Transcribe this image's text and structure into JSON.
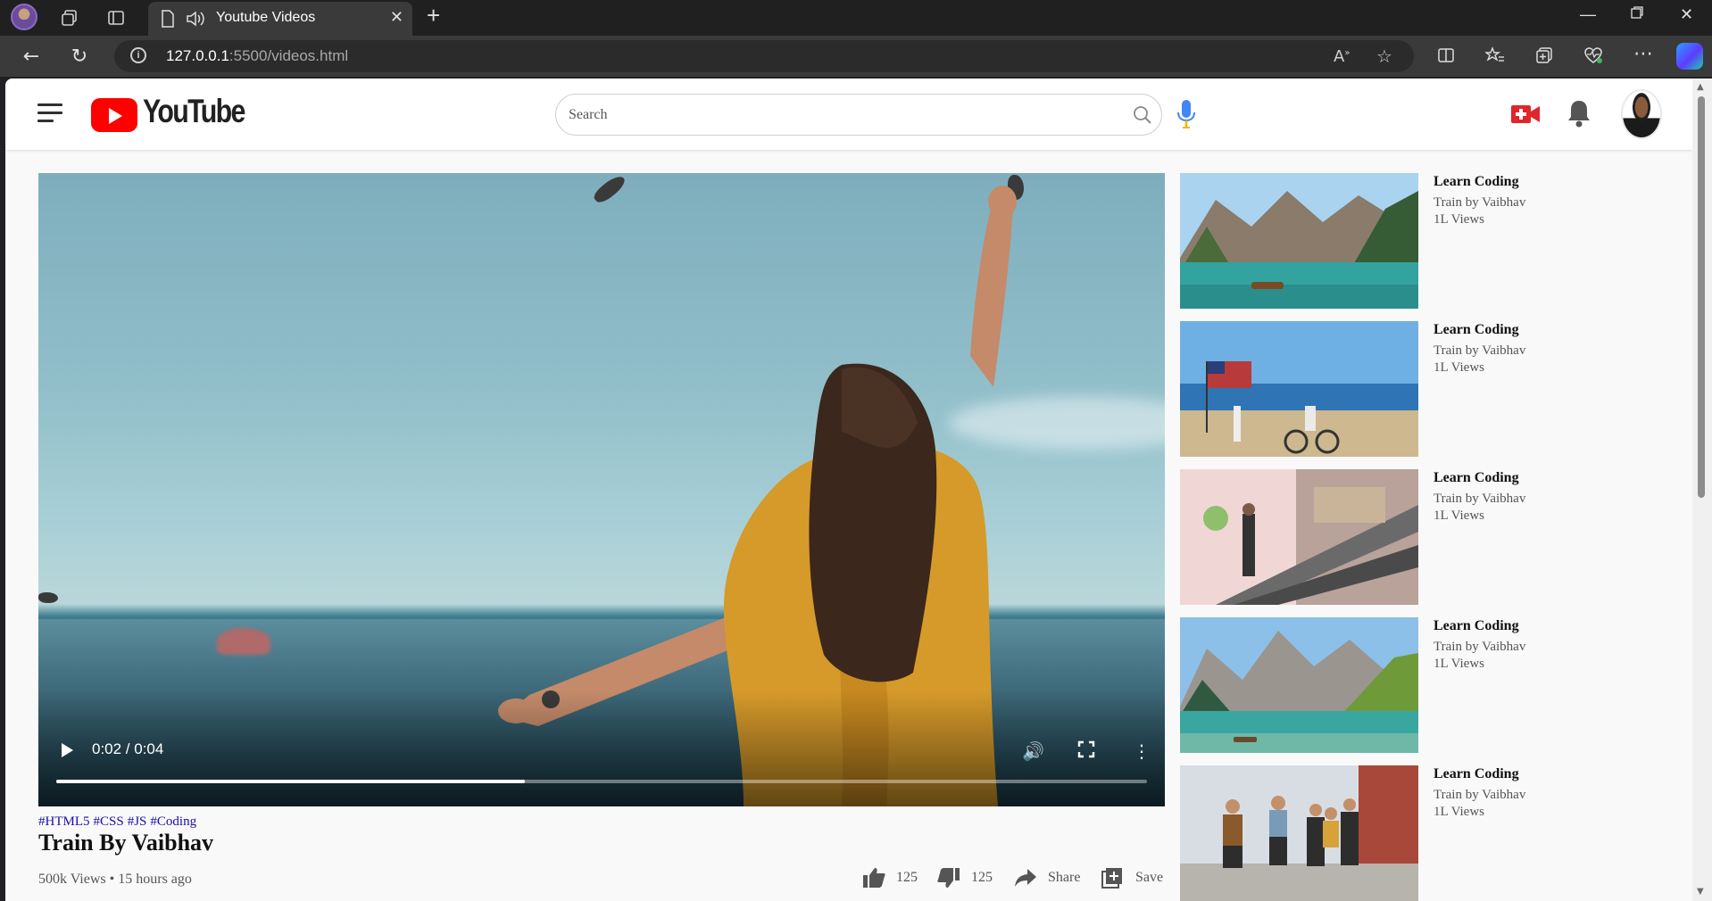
{
  "browser": {
    "tab_title": "Youtube Videos",
    "url_host": "127.0.0.1",
    "url_path": ":5500/videos.html"
  },
  "header": {
    "logo_text": "YouTube",
    "search_placeholder": "Search"
  },
  "player": {
    "time": "0:02 / 0:04",
    "progress": 0.43
  },
  "video": {
    "tags": [
      "#HTML5",
      "#CSS",
      "#JS",
      "#Coding"
    ],
    "title": "Train By Vaibhav",
    "meta": "500k Views • 15 hours ago",
    "likes": "125",
    "dislikes": "125",
    "share_label": "Share",
    "save_label": "Save"
  },
  "sidebar": {
    "items": [
      {
        "title": "Learn Coding",
        "channel": "Train by Vaibhav",
        "views": "1L Views",
        "scene": "lake-mountains"
      },
      {
        "title": "Learn Coding",
        "channel": "Train by Vaibhav",
        "views": "1L Views",
        "scene": "beach-flag-bicycle"
      },
      {
        "title": "Learn Coding",
        "channel": "Train by Vaibhav",
        "views": "1L Views",
        "scene": "escalator-mall"
      },
      {
        "title": "Learn Coding",
        "channel": "Train by Vaibhav",
        "views": "1L Views",
        "scene": "alpine-lake"
      },
      {
        "title": "Learn Coding",
        "channel": "Train by Vaibhav",
        "views": "1L Views",
        "scene": "friends-walking"
      }
    ]
  },
  "colors": {
    "brand_red": "#ff0000",
    "mic_blue": "#4285f4",
    "tag_blue": "#1a0dab"
  }
}
